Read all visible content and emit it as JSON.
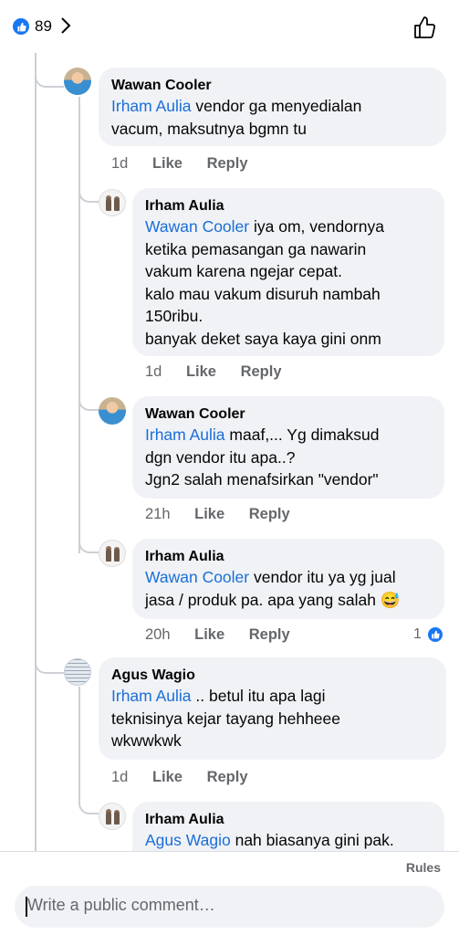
{
  "header": {
    "like_count": "89",
    "like_icon": "thumbs-up-filled",
    "chevron_icon": "chevron-right",
    "like_button_icon": "thumbs-up-outline"
  },
  "comments": [
    {
      "author": "Wawan Cooler",
      "mention": "Irham Aulia",
      "text": " vendor ga menyedialan\nvacum, maksutnya bgmn tu",
      "time": "1d",
      "like": "Like",
      "reply": "Reply"
    },
    {
      "author": "Irham Aulia",
      "mention": "Wawan Cooler",
      "text": " iya om, vendornya\nketika pemasangan ga nawarin\nvakum karena ngejar cepat.\nkalo mau vakum disuruh nambah\n150ribu.\nbanyak deket saya kaya gini onm",
      "time": "1d",
      "like": "Like",
      "reply": "Reply"
    },
    {
      "author": "Wawan Cooler",
      "mention": "Irham Aulia",
      "text": " maaf,... Yg dimaksud\ndgn vendor itu apa..?\nJgn2 salah menafsirkan \"vendor\"",
      "time": "21h",
      "like": "Like",
      "reply": "Reply"
    },
    {
      "author": "Irham Aulia",
      "mention": "Wawan Cooler",
      "text": " vendor itu ya yg jual\njasa / produk pa. apa yang salah 😅",
      "time": "20h",
      "like": "Like",
      "reply": "Reply",
      "reaction_count": "1"
    },
    {
      "author": "Agus Wagio",
      "mention": "Irham Aulia",
      "text": " .. betul itu apa lagi\nteknisinya kejar tayang hehheee\nwkwwkwk",
      "time": "1d",
      "like": "Like",
      "reply": "Reply"
    },
    {
      "author": "Irham Aulia",
      "mention": "Agus Wagio",
      "text": " nah biasanya gini pak.",
      "time": "",
      "like": "",
      "reply": ""
    }
  ],
  "footer": {
    "rules": "Rules",
    "composer_placeholder": "Write a public comment…"
  },
  "colors": {
    "accent": "#1877f2",
    "mention": "#1a6ed8",
    "bubble": "#f0f2f5",
    "meta": "#65676b"
  }
}
